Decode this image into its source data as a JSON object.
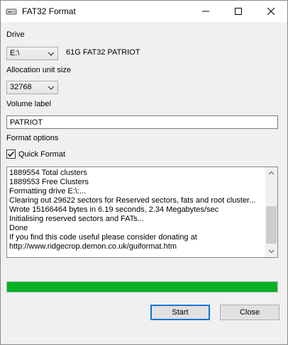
{
  "window": {
    "title": "FAT32 Format",
    "controls": {
      "minimize": "minimize",
      "maximize": "maximize",
      "close": "close"
    }
  },
  "drive": {
    "label": "Drive",
    "selected": "E:\\",
    "description": "61G FAT32 PATRIOT"
  },
  "allocation": {
    "label": "Allocation unit size",
    "selected": "32768"
  },
  "volume": {
    "label": "Volume label",
    "value": "PATRIOT"
  },
  "format_options": {
    "label": "Format options",
    "quick_format": {
      "label": "Quick Format",
      "checked": true
    }
  },
  "log": {
    "lines": [
      "1889554 Total clusters",
      "1889553 Free Clusters",
      "Formatting drive E:\\:...",
      "Clearing out 29622 sectors for Reserved sectors, fats and root cluster...",
      "Wrote 15166464 bytes in 6.19 seconds, 2.34 Megabytes/sec",
      "Initialising reserved sectors and FATs...",
      "Done",
      "If you find this code useful please consider donating at",
      "http://www.ridgecrop.demon.co.uk/guiformat.htm"
    ]
  },
  "progress": {
    "percent": 100,
    "color": "#06b025"
  },
  "buttons": {
    "start": "Start",
    "close": "Close"
  },
  "icons": {
    "app": "drive-icon",
    "dropdown": "chevron-down-icon",
    "check": "check-icon",
    "scroll_up": "scroll-up-arrow-icon",
    "scroll_down": "scroll-down-arrow-icon"
  }
}
